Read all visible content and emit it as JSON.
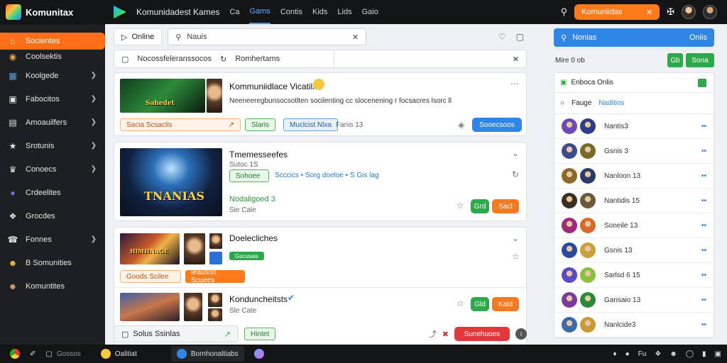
{
  "topbar": {
    "logo_text": "Komunitax",
    "app_title": "Komunidadest Kames",
    "tabs": [
      "Ca",
      "Gams",
      "Contis",
      "Kids",
      "Lids",
      "Gaio"
    ],
    "active_tab": 1,
    "search_label": "Komuniidas"
  },
  "sidebar": {
    "items": [
      {
        "label": "Socientes",
        "icon": "home-icon",
        "active": true,
        "chevron": false
      },
      {
        "label": "Coolsektis",
        "icon": "community-icon",
        "chevron": false
      },
      {
        "label": "Koolgede",
        "icon": "grid-icon",
        "chevron": true
      },
      {
        "label": "Fabocitos",
        "icon": "list-icon",
        "chevron": true
      },
      {
        "label": "Amoauilfers",
        "icon": "chat-icon",
        "chevron": true
      },
      {
        "label": "Srotunis",
        "icon": "star-icon",
        "chevron": true
      },
      {
        "label": "Conoecs",
        "icon": "trophy-icon",
        "chevron": true
      },
      {
        "label": "Crdeelites",
        "icon": "globe-icon",
        "chevron": false
      },
      {
        "label": "Grocdes",
        "icon": "gamepad-icon",
        "chevron": false
      },
      {
        "label": "Fonnes",
        "icon": "bell-icon",
        "chevron": true
      },
      {
        "label": "B Somunities",
        "icon": "group-icon",
        "chevron": false
      },
      {
        "label": "Komuntites",
        "icon": "users-icon",
        "chevron": false
      }
    ]
  },
  "main": {
    "online_label": "Online",
    "search_value": "Nauis",
    "filter_label": "Nocossfeleranssocos",
    "filter_label2": "Romhertams",
    "posts": [
      {
        "title": "Kommuniidlace Vicatilx",
        "body": "Neeneeregbunsocsotlten socilenting cc slocenening  r focsacres lsorc ll",
        "thumb_text": "Sahedet",
        "tag1": "Sacia  Scsaclis",
        "tag2": "Slaris",
        "tag3": "Muclcist Nlxa",
        "meta": "Fanis 13",
        "action": "Sooecsoos"
      },
      {
        "title": "Tmemesseefes",
        "sub": "Sutoc 1S",
        "thumb_text": "TNANIAS",
        "tag1": "Sohoee",
        "meta_line": "Scccics  •  Sorg doeloe  •  S Gis lag",
        "highlight": "Nodaligoed 3",
        "meta": "Sie Cale",
        "btn_green": "Grd",
        "btn_orange": "Sacl"
      },
      {
        "title": "Doelecliches",
        "tag1": "Gscusais",
        "thumb_text": "HIMHNAGE",
        "tag_a": "Goods  Scilee",
        "tag_b": "Ieausoo  Scuees"
      },
      {
        "title": "Konduncheitsts",
        "meta": "Sle Cate",
        "btn_green": "Gld",
        "btn_orange": "Kald"
      }
    ],
    "bottom": {
      "label": "Solus Ssinlas",
      "chip": "Hintet",
      "action": "Sunehuoes"
    }
  },
  "right": {
    "search_label": "Nonlas",
    "search_state": "Oniis",
    "status_line": "Mire  0  ob",
    "btn_sq": "Gb",
    "btn_wide": "Sona",
    "list_title": "Enboca Onlis",
    "sub_label": "Fauge",
    "sub_link": "Naditios",
    "people": [
      {
        "name": "Nantis3",
        "c1": "#6d4ab8",
        "c2": "#2e3c8a"
      },
      {
        "name": "Gsnis 3",
        "c1": "#3d4a8f",
        "c2": "#7a6a2a"
      },
      {
        "name": "Nanloon 13",
        "c1": "#8a6a2a",
        "c2": "#2a3c6a"
      },
      {
        "name": "Nantidis 15",
        "c1": "#3a3020",
        "c2": "#6a5a3a"
      },
      {
        "name": "Soneile 13",
        "c1": "#a02a7a",
        "c2": "#d86a2a"
      },
      {
        "name": "Gsnis 13",
        "c1": "#2a4a9a",
        "c2": "#c8a040"
      },
      {
        "name": "Sarlsd 6 15",
        "c1": "#5a4ac8",
        "c2": "#8ac040"
      },
      {
        "name": "Gansaio 13",
        "c1": "#7a3a9a",
        "c2": "#2a8a3a"
      },
      {
        "name": "Nanlcide3",
        "c1": "#3a6aa8",
        "c2": "#c89a3a"
      }
    ]
  },
  "taskbar": {
    "items": [
      "Gossos",
      "Oalitiat",
      "Bornhonaltiabs"
    ],
    "time": "Fu"
  }
}
